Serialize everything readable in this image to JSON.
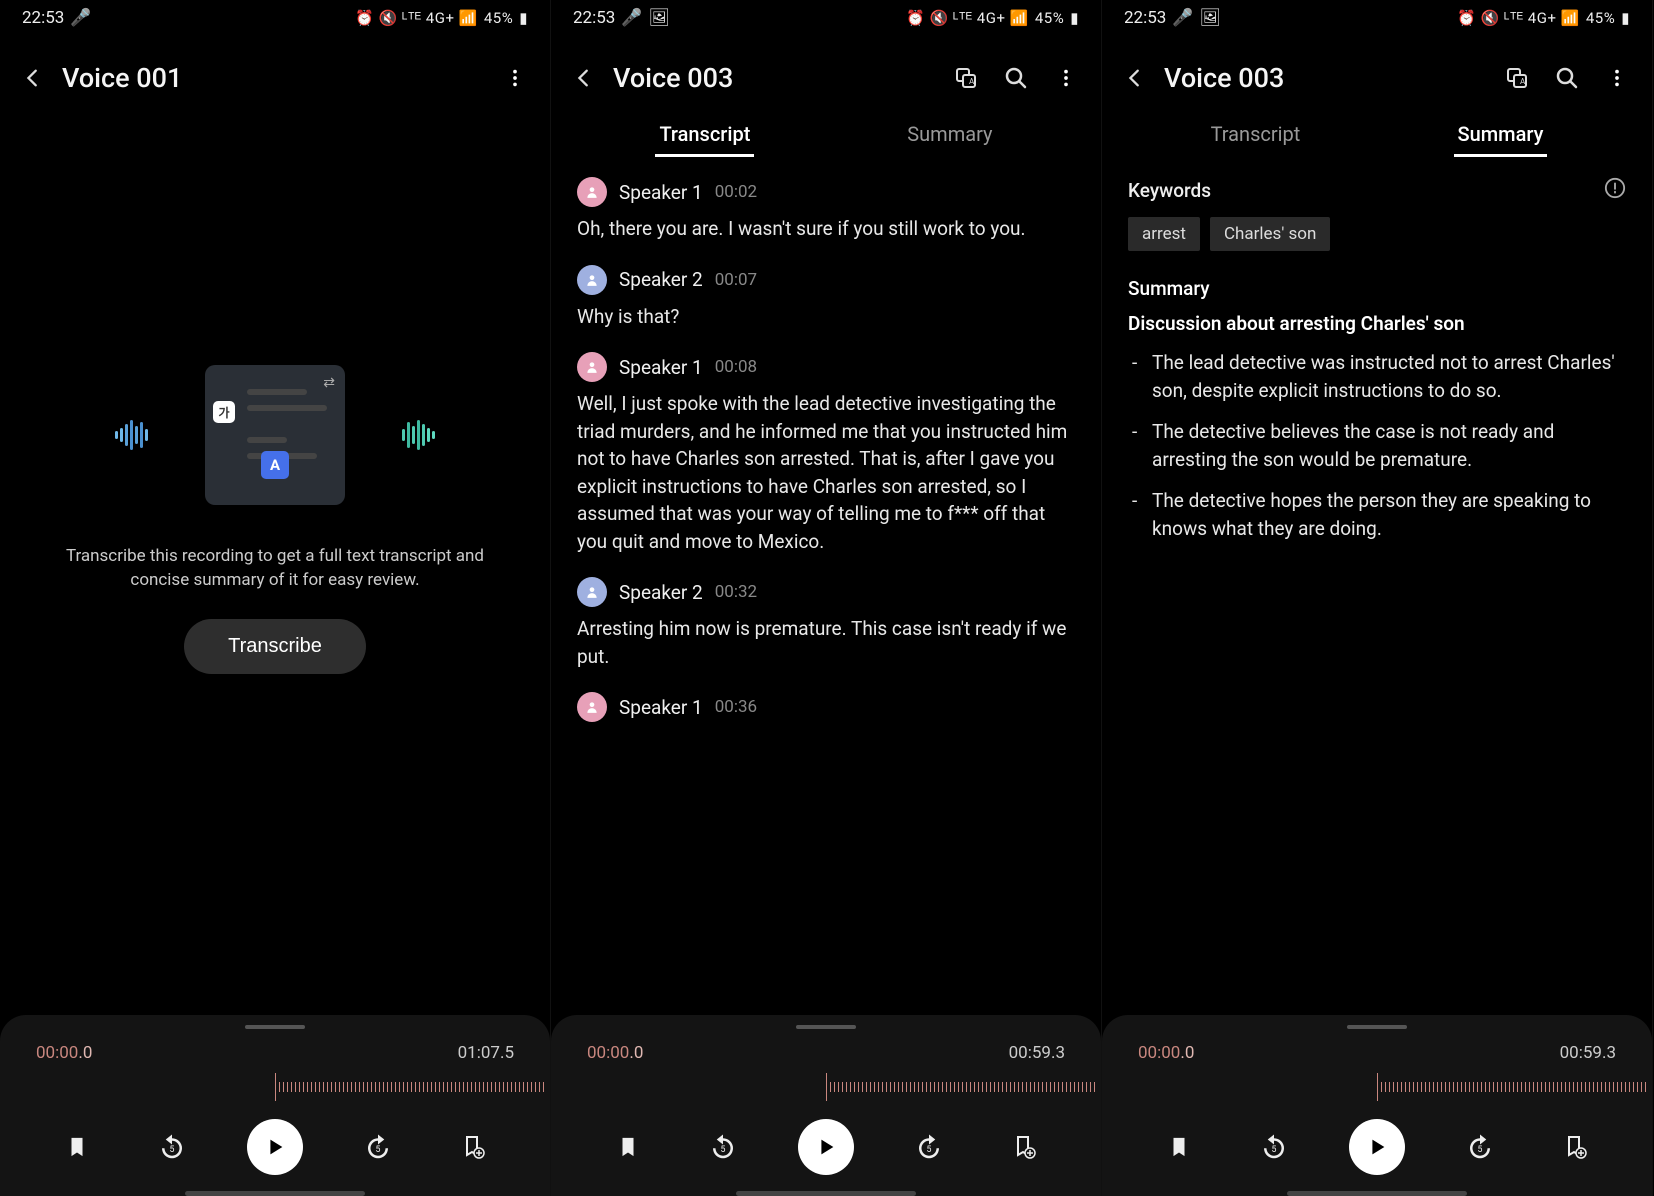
{
  "status": {
    "time": "22:53",
    "battery": "45%",
    "right_icons": "⏰ 🔇 LTE 4G+ 📶"
  },
  "screen1": {
    "title": "Voice 001",
    "prompt": "Transcribe this recording to get a full text transcript and concise summary of it for easy review.",
    "button": "Transcribe",
    "time_current": "00:00",
    "time_current_frac": ".0",
    "time_duration": "01:07.5"
  },
  "screen2": {
    "title": "Voice 003",
    "tab_transcript": "Transcript",
    "tab_summary": "Summary",
    "messages": [
      {
        "speaker": "Speaker 1",
        "color": "pink",
        "time": "00:02",
        "text": "Oh, there you are. I wasn't sure if you still work to you."
      },
      {
        "speaker": "Speaker 2",
        "color": "blue",
        "time": "00:07",
        "text": "Why is that?"
      },
      {
        "speaker": "Speaker 1",
        "color": "pink",
        "time": "00:08",
        "text": "Well, I just spoke with the lead detective investigating the triad murders, and he informed me that you instructed him not to have Charles son arrested. That is, after I gave you explicit instructions to have Charles son arrested, so I assumed that was your way of telling me to f*** off that you quit and move to Mexico."
      },
      {
        "speaker": "Speaker 2",
        "color": "blue",
        "time": "00:32",
        "text": "Arresting him now is premature. This case isn't ready if we put."
      },
      {
        "speaker": "Speaker 1",
        "color": "pink",
        "time": "00:36",
        "text": ""
      }
    ],
    "time_current": "00:00",
    "time_current_frac": ".0",
    "time_duration": "00:59.3"
  },
  "screen3": {
    "title": "Voice 003",
    "tab_transcript": "Transcript",
    "tab_summary": "Summary",
    "keywords_label": "Keywords",
    "keywords": [
      "arrest",
      "Charles' son"
    ],
    "summary_label": "Summary",
    "summary_title": "Discussion about arresting Charles' son",
    "summary_points": [
      "The lead detective was instructed not to arrest Charles' son, despite explicit instructions to do so.",
      "The detective believes the case is not ready and arresting the son would be premature.",
      "The detective hopes the person they are speaking to knows what they are doing."
    ],
    "time_current": "00:00",
    "time_current_frac": ".0",
    "time_duration": "00:59.3"
  }
}
